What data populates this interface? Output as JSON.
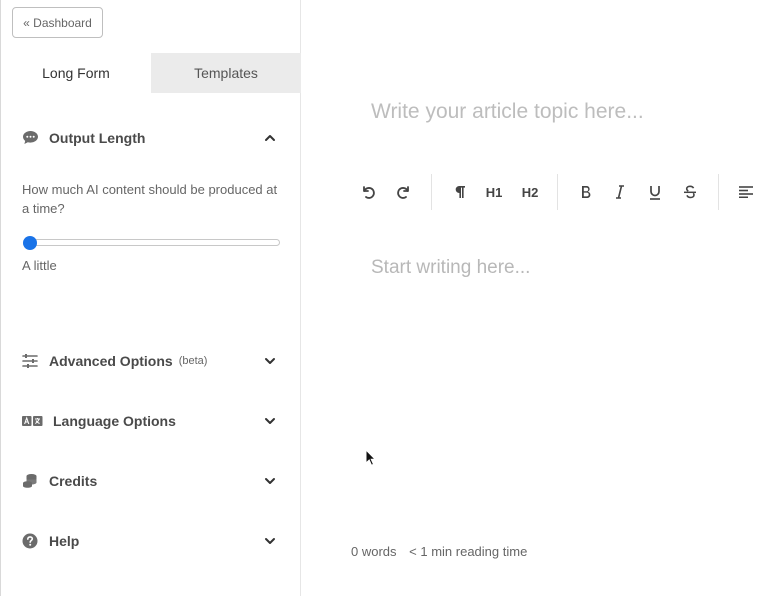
{
  "nav": {
    "dashboard_label": "« Dashboard"
  },
  "tabs": [
    {
      "label": "Long Form",
      "active": true
    },
    {
      "label": "Templates",
      "active": false
    }
  ],
  "sidebar": {
    "output_length": {
      "title": "Output Length",
      "icon": "chat-bubble-icon",
      "expanded": true,
      "question": "How much AI content should be produced at a time?",
      "slider_value": 0,
      "slider_label": "A little"
    },
    "advanced": {
      "title": "Advanced Options",
      "badge": "(beta)",
      "icon": "sliders-icon"
    },
    "language": {
      "title": "Language Options",
      "icon": "translate-icon"
    },
    "credits": {
      "title": "Credits",
      "icon": "coins-icon"
    },
    "help": {
      "title": "Help",
      "icon": "question-circle-icon"
    }
  },
  "editor": {
    "topic_placeholder": "Write your article topic here...",
    "body_placeholder": "Start writing here...",
    "toolbar": {
      "h1_label": "H1",
      "h2_label": "H2"
    }
  },
  "footer": {
    "word_count": "0 words",
    "reading_time": "< 1 min reading time"
  },
  "colors": {
    "accent": "#1a73e8",
    "inactive_tab_bg": "#ebebeb"
  }
}
